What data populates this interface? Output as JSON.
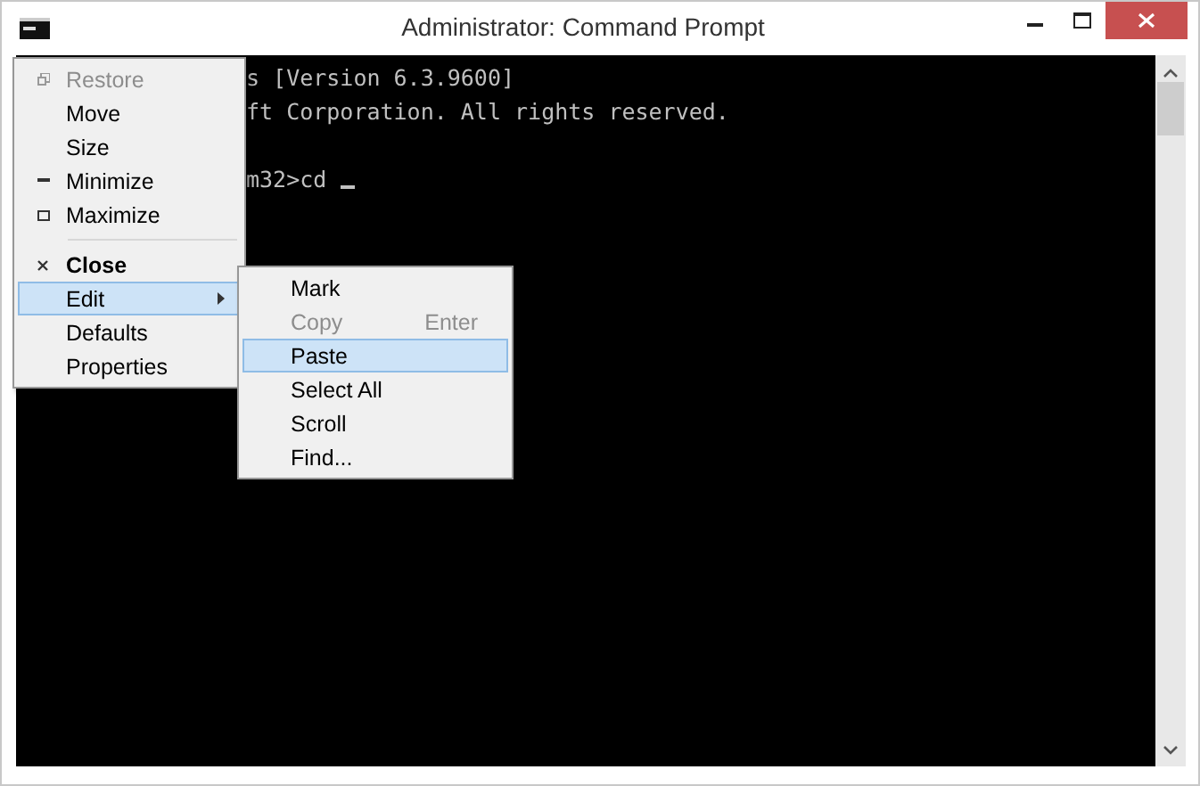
{
  "window": {
    "title": "Administrator: Command Prompt"
  },
  "console": {
    "lines": [
      "s [Version 6.3.9600]",
      "ft Corporation. All rights reserved.",
      "m32>cd"
    ]
  },
  "system_menu": {
    "groups": [
      [
        {
          "label": "Restore",
          "disabled": true,
          "selected": false,
          "default": false,
          "submenu": false
        },
        {
          "label": "Move",
          "disabled": false,
          "selected": false,
          "default": false,
          "submenu": false
        },
        {
          "label": "Size",
          "disabled": false,
          "selected": false,
          "default": false,
          "submenu": false
        },
        {
          "label": "Minimize",
          "disabled": false,
          "selected": false,
          "default": false,
          "submenu": false
        },
        {
          "label": "Maximize",
          "disabled": false,
          "selected": false,
          "default": false,
          "submenu": false
        }
      ],
      [
        {
          "label": "Close",
          "disabled": false,
          "selected": false,
          "default": true,
          "submenu": false
        },
        {
          "label": "Edit",
          "disabled": false,
          "selected": true,
          "default": false,
          "submenu": true
        },
        {
          "label": "Defaults",
          "disabled": false,
          "selected": false,
          "default": false,
          "submenu": false
        },
        {
          "label": "Properties",
          "disabled": false,
          "selected": false,
          "default": false,
          "submenu": false
        }
      ]
    ]
  },
  "edit_menu": {
    "items": [
      {
        "label": "Mark",
        "disabled": false,
        "selected": false
      },
      {
        "label": "Copy",
        "shortcut": "Enter",
        "disabled": true,
        "selected": false
      },
      {
        "label": "Paste",
        "disabled": false,
        "selected": true
      },
      {
        "label": "Select All",
        "disabled": false,
        "selected": false
      },
      {
        "label": "Scroll",
        "disabled": false,
        "selected": false
      },
      {
        "label": "Find...",
        "disabled": false,
        "selected": false
      }
    ]
  }
}
